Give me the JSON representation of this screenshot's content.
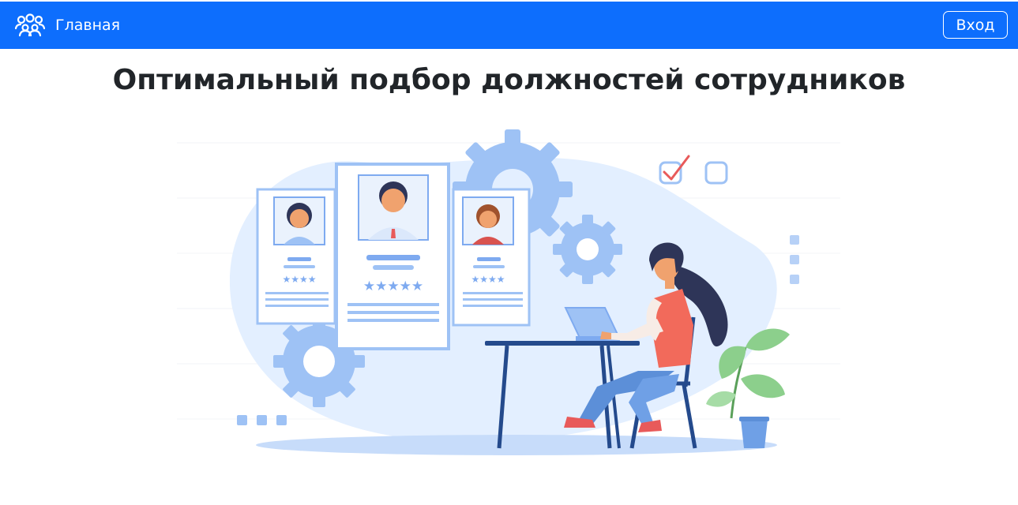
{
  "navbar": {
    "brand_label": "Главная",
    "brand_icon": "people-group-icon",
    "login_label": "Вход",
    "background_color": "#0d6efd"
  },
  "main": {
    "title": "Оптимальный подбор должностей сотрудников",
    "illustration": "recruitment-illustration"
  }
}
